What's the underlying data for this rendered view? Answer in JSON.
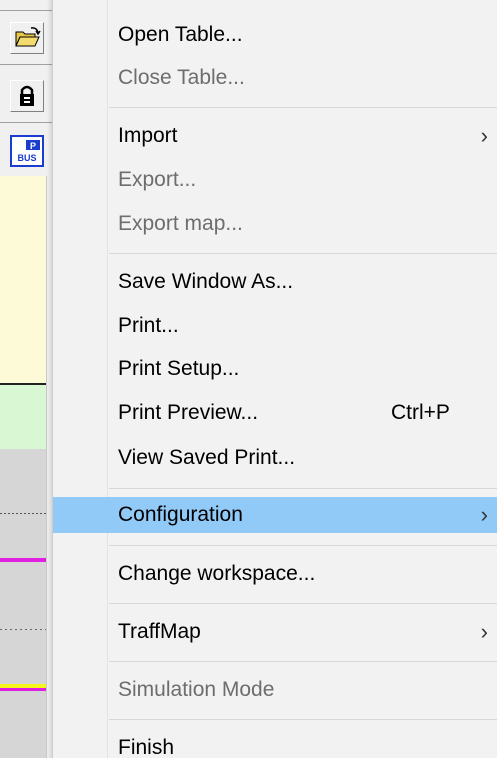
{
  "menu": {
    "items": [
      {
        "label": "Open Table...",
        "enabled": true
      },
      {
        "label": "Close Table...",
        "enabled": false
      },
      {
        "label": "Import",
        "enabled": true,
        "submenu": true
      },
      {
        "label": "Export...",
        "enabled": false
      },
      {
        "label": "Export map...",
        "enabled": false
      },
      {
        "label": "Save Window As...",
        "enabled": true
      },
      {
        "label": "Print...",
        "enabled": true
      },
      {
        "label": "Print Setup...",
        "enabled": true
      },
      {
        "label": "Print Preview...",
        "enabled": true,
        "shortcut": "Ctrl+P"
      },
      {
        "label": "View Saved Print...",
        "enabled": true
      },
      {
        "label": "Configuration",
        "enabled": true,
        "submenu": true,
        "highlighted": true
      },
      {
        "label": "Change workspace...",
        "enabled": true
      },
      {
        "label": "TraffMap",
        "enabled": true,
        "submenu": true
      },
      {
        "label": "Simulation Mode",
        "enabled": false
      },
      {
        "label": "Finish",
        "enabled": true
      }
    ],
    "submenu_arrow": "›"
  },
  "toolbar": {
    "pbus_icon_text_top": "P",
    "pbus_icon_text_bottom": "BUS"
  },
  "colors": {
    "menu_background": "#f2f2f2",
    "highlight": "#91c9f7",
    "disabled_text": "#6d6d6d",
    "map_yellow": "#fdfbd7",
    "map_green": "#d9f7d3",
    "map_grey": "#d6d6d6",
    "map_magenta": "#e020e0",
    "map_yellow_line": "#f5f51a"
  }
}
